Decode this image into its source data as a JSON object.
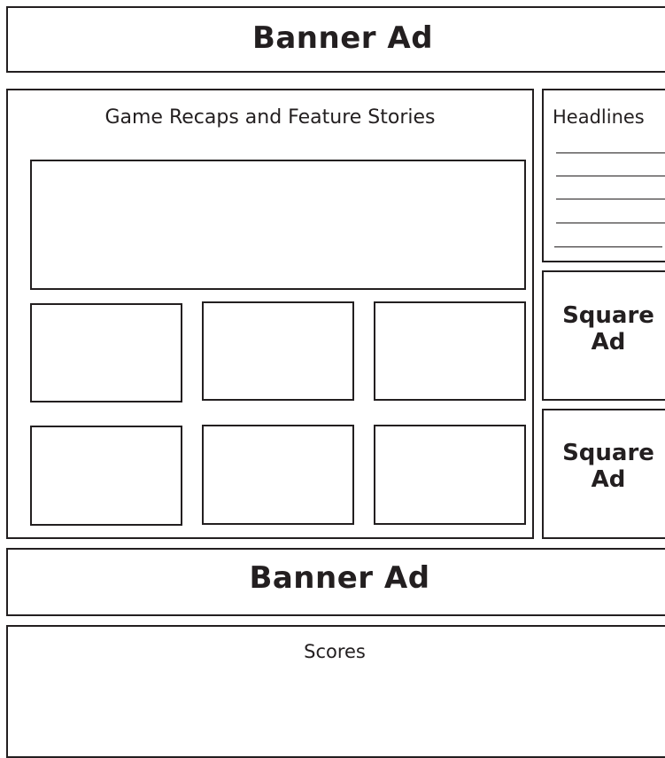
{
  "top_banner": {
    "label": "Banner Ad"
  },
  "main": {
    "title": "Game Recaps and Feature Stories",
    "thumbnail_rows": [
      {
        "items": [
          "",
          "",
          ""
        ]
      },
      {
        "items": [
          "",
          "",
          ""
        ]
      }
    ]
  },
  "headlines": {
    "title": "Headlines",
    "line_count": 5
  },
  "square_ads": [
    {
      "line1": "Square",
      "line2": "Ad"
    },
    {
      "line1": "Square",
      "line2": "Ad"
    }
  ],
  "middle_banner": {
    "label": "Banner Ad"
  },
  "scores": {
    "title": "Scores"
  }
}
